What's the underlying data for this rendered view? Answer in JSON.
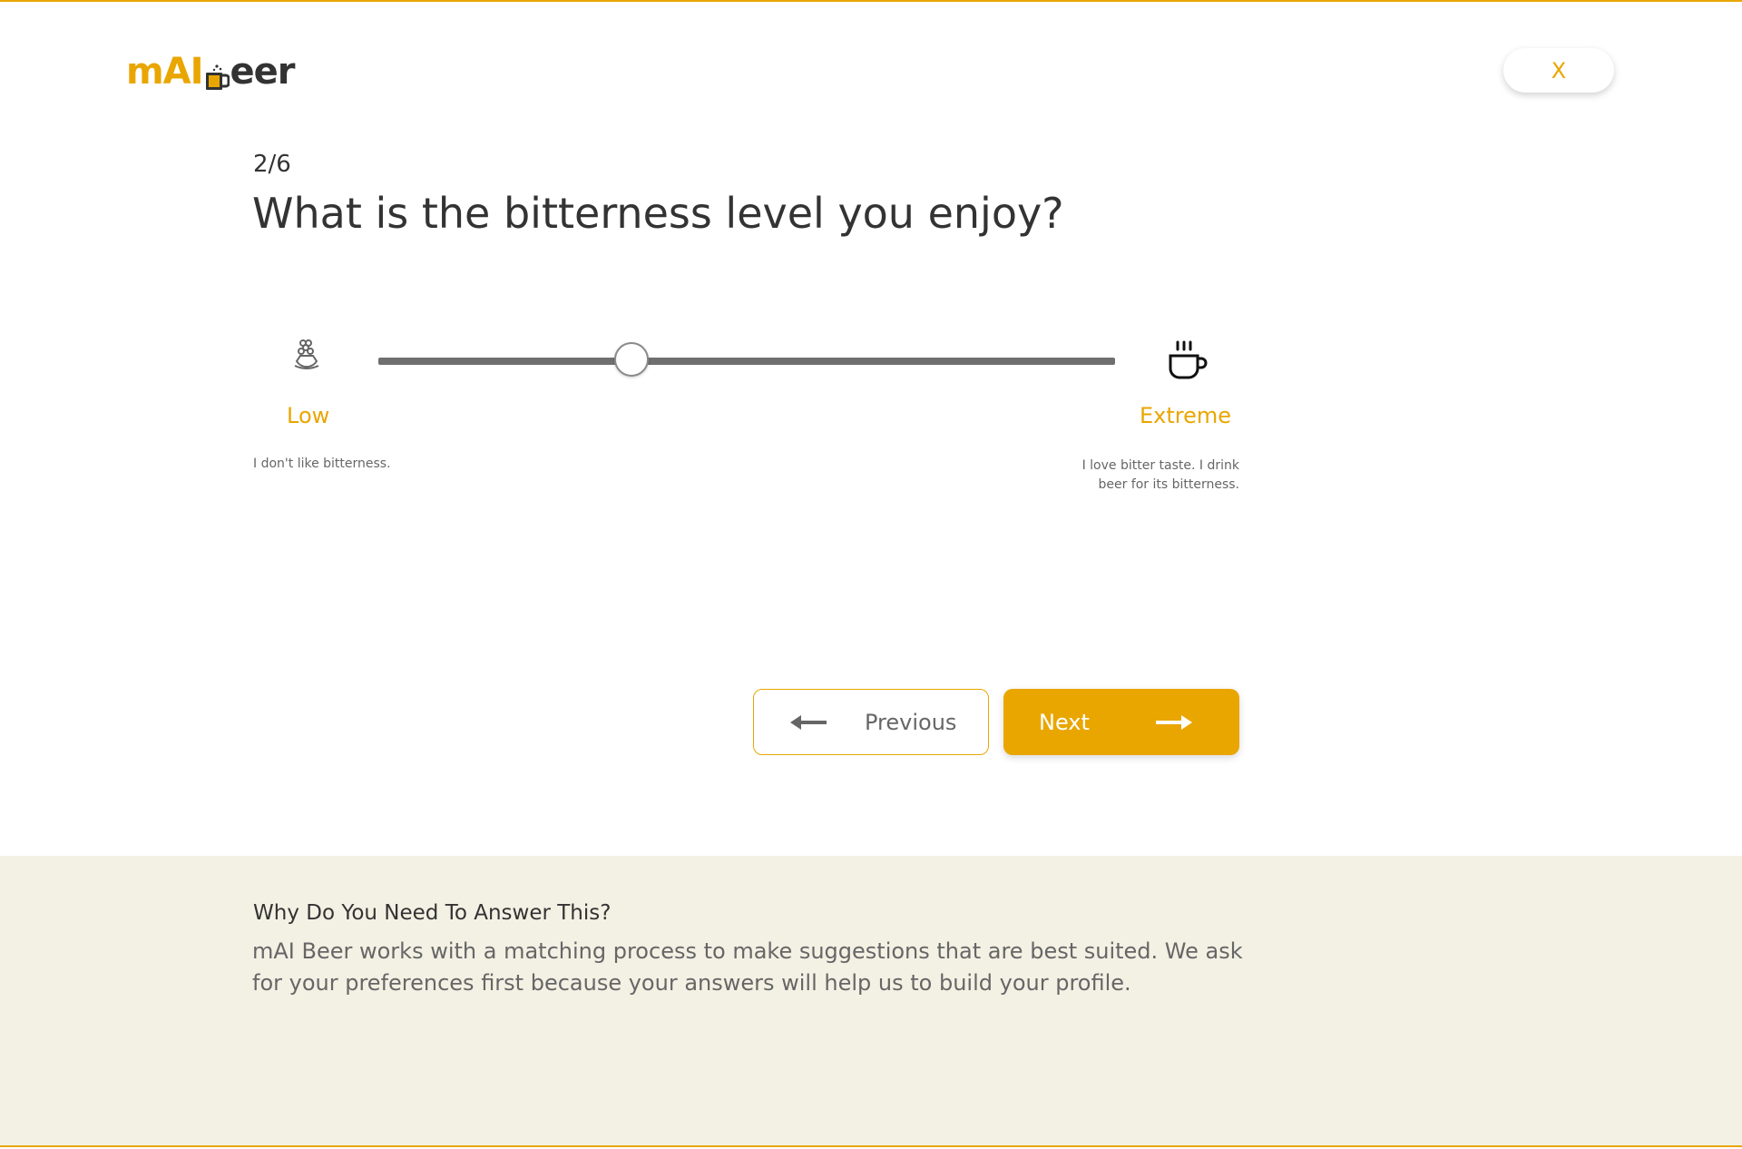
{
  "header": {
    "logo_part1": "mAI",
    "logo_part2": "eer",
    "close_label": "X"
  },
  "quiz": {
    "step": "2/6",
    "question": "What is the bitterness level you enjoy?"
  },
  "slider": {
    "min_label": "Low",
    "max_label": "Extreme",
    "min_description": "I don't like bitterness.",
    "max_description": "I love bitter taste. I drink beer for its bitterness.",
    "value_fraction": 0.344,
    "min_icon": "hop-bowl-icon",
    "max_icon": "coffee-cup-icon"
  },
  "nav": {
    "previous_label": "Previous",
    "next_label": "Next",
    "previous_icon": "arrow-left-icon",
    "next_icon": "arrow-right-icon"
  },
  "info": {
    "title": "Why Do You Need To Answer This?",
    "text": "mAI Beer works with a matching process to make suggestions that are best suited. We ask for your preferences first because your answers will help us to build your profile."
  },
  "colors": {
    "accent": "#e9a600",
    "text_dark": "#333333",
    "text_muted": "#666666",
    "info_background": "#f3f1e4",
    "slider_track": "#6f6f6f"
  }
}
